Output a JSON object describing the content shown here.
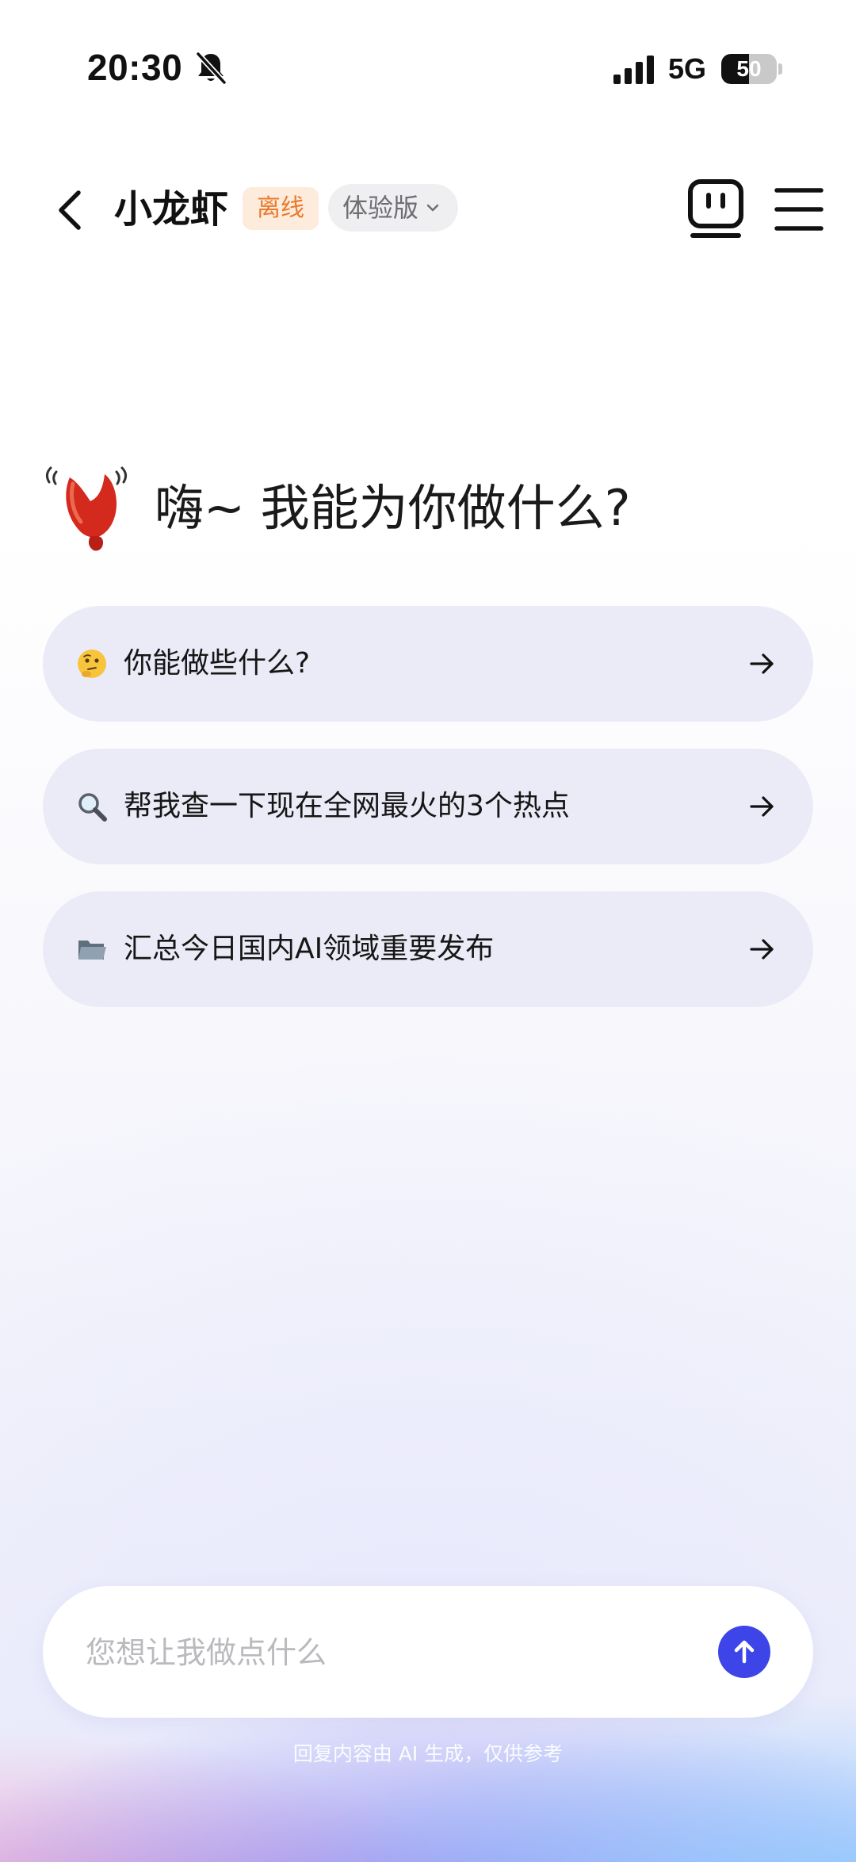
{
  "status_bar": {
    "time": "20:30",
    "network": "5G",
    "battery_level": "50",
    "battery_fraction": 0.5,
    "icons": [
      "bell-muted-icon",
      "signal-bars-icon",
      "battery-icon"
    ]
  },
  "nav": {
    "back_icon": "chevron-left-icon",
    "agent_name": "小龙虾",
    "status_badge": "离线",
    "version_label": "体验版",
    "bot_icon": "robot-face-icon",
    "menu_icon": "hamburger-menu-icon"
  },
  "greeting": {
    "icon": "lobster-claw-icon",
    "text": "嗨~ 我能为你做什么?"
  },
  "suggestions": [
    {
      "icon": "thinking-face-icon",
      "text": "你能做些什么?"
    },
    {
      "icon": "magnifier-icon",
      "text": "帮我查一下现在全网最火的3个热点"
    },
    {
      "icon": "folder-icon",
      "text": "汇总今日国内AI领域重要发布"
    }
  ],
  "composer": {
    "placeholder": "您想让我做点什么",
    "value": "",
    "send_icon": "arrow-up-icon"
  },
  "footer": {
    "disclaimer": "回复内容由 AI 生成，仅供参考"
  },
  "colors": {
    "accent": "#3d45e8",
    "badge_text": "#ea7a2c",
    "badge_bg": "#fdebdc",
    "card_bg": "#ebebf7"
  }
}
